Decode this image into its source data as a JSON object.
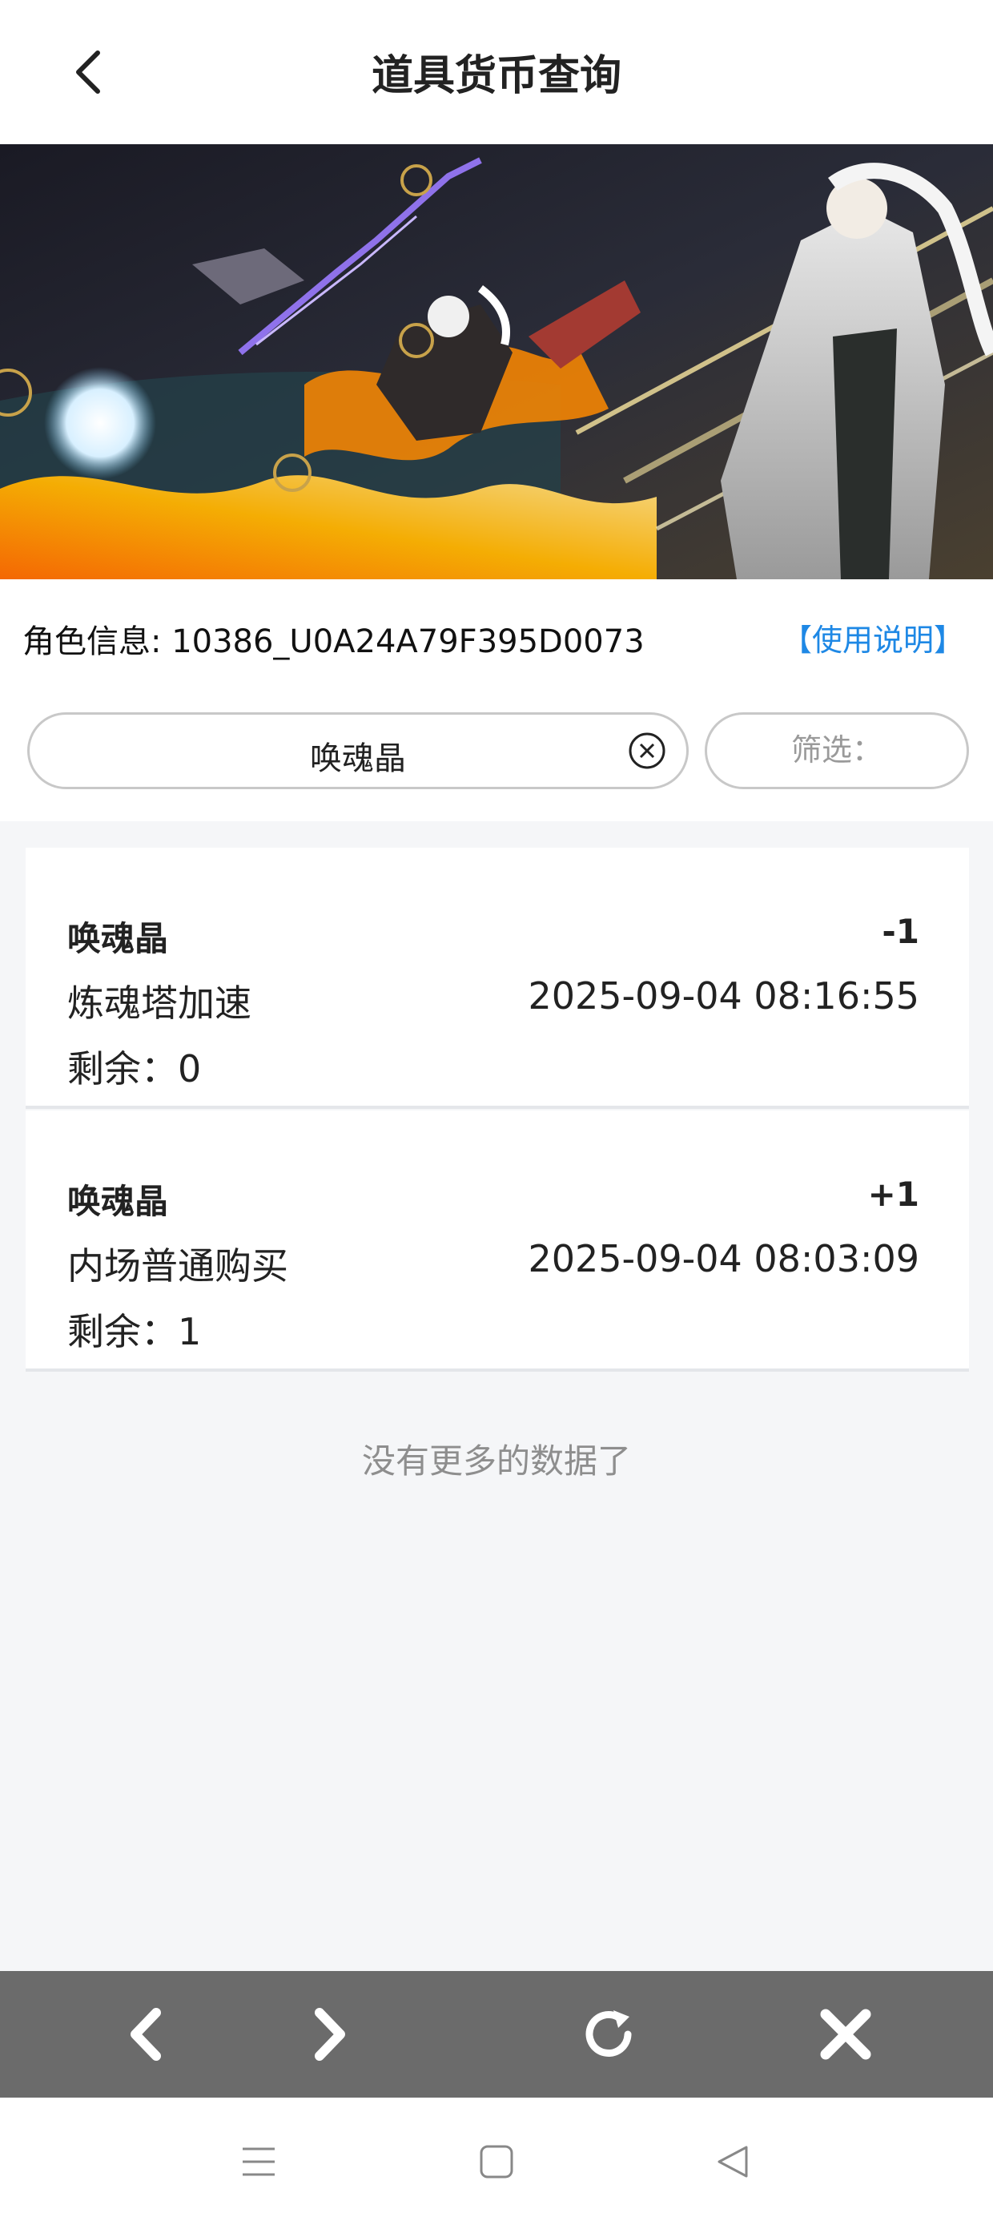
{
  "header": {
    "title": "道具货币查询",
    "back_icon": "chevron-left-icon"
  },
  "banner": {
    "description_icon": "game-artwork-banner"
  },
  "info": {
    "role_label": "角色信息: 10386_U0A24A79F395D0073",
    "help_link": "【使用说明】"
  },
  "search": {
    "value": "唤魂晶",
    "clear_icon": "clear-circle-icon"
  },
  "filter": {
    "label": "筛选："
  },
  "records": [
    {
      "name": "唤魂晶",
      "change": "-1",
      "source": "炼魂塔加速",
      "time": "2025-09-04 08:16:55",
      "remain": "剩余：0"
    },
    {
      "name": "唤魂晶",
      "change": "+1",
      "source": "内场普通购买",
      "time": "2025-09-04 08:03:09",
      "remain": "剩余：1"
    }
  ],
  "footer": {
    "no_more": "没有更多的数据了"
  },
  "browser_bar": {
    "icons": [
      "chevron-left-icon",
      "chevron-right-icon",
      "refresh-icon",
      "close-icon"
    ]
  },
  "system_nav": {
    "icons": [
      "menu-icon",
      "home-icon",
      "back-triangle-icon"
    ]
  },
  "colors": {
    "link": "#1e88e5",
    "page_bg": "#f5f6f8",
    "browser_bar": "#6b6b6b"
  }
}
